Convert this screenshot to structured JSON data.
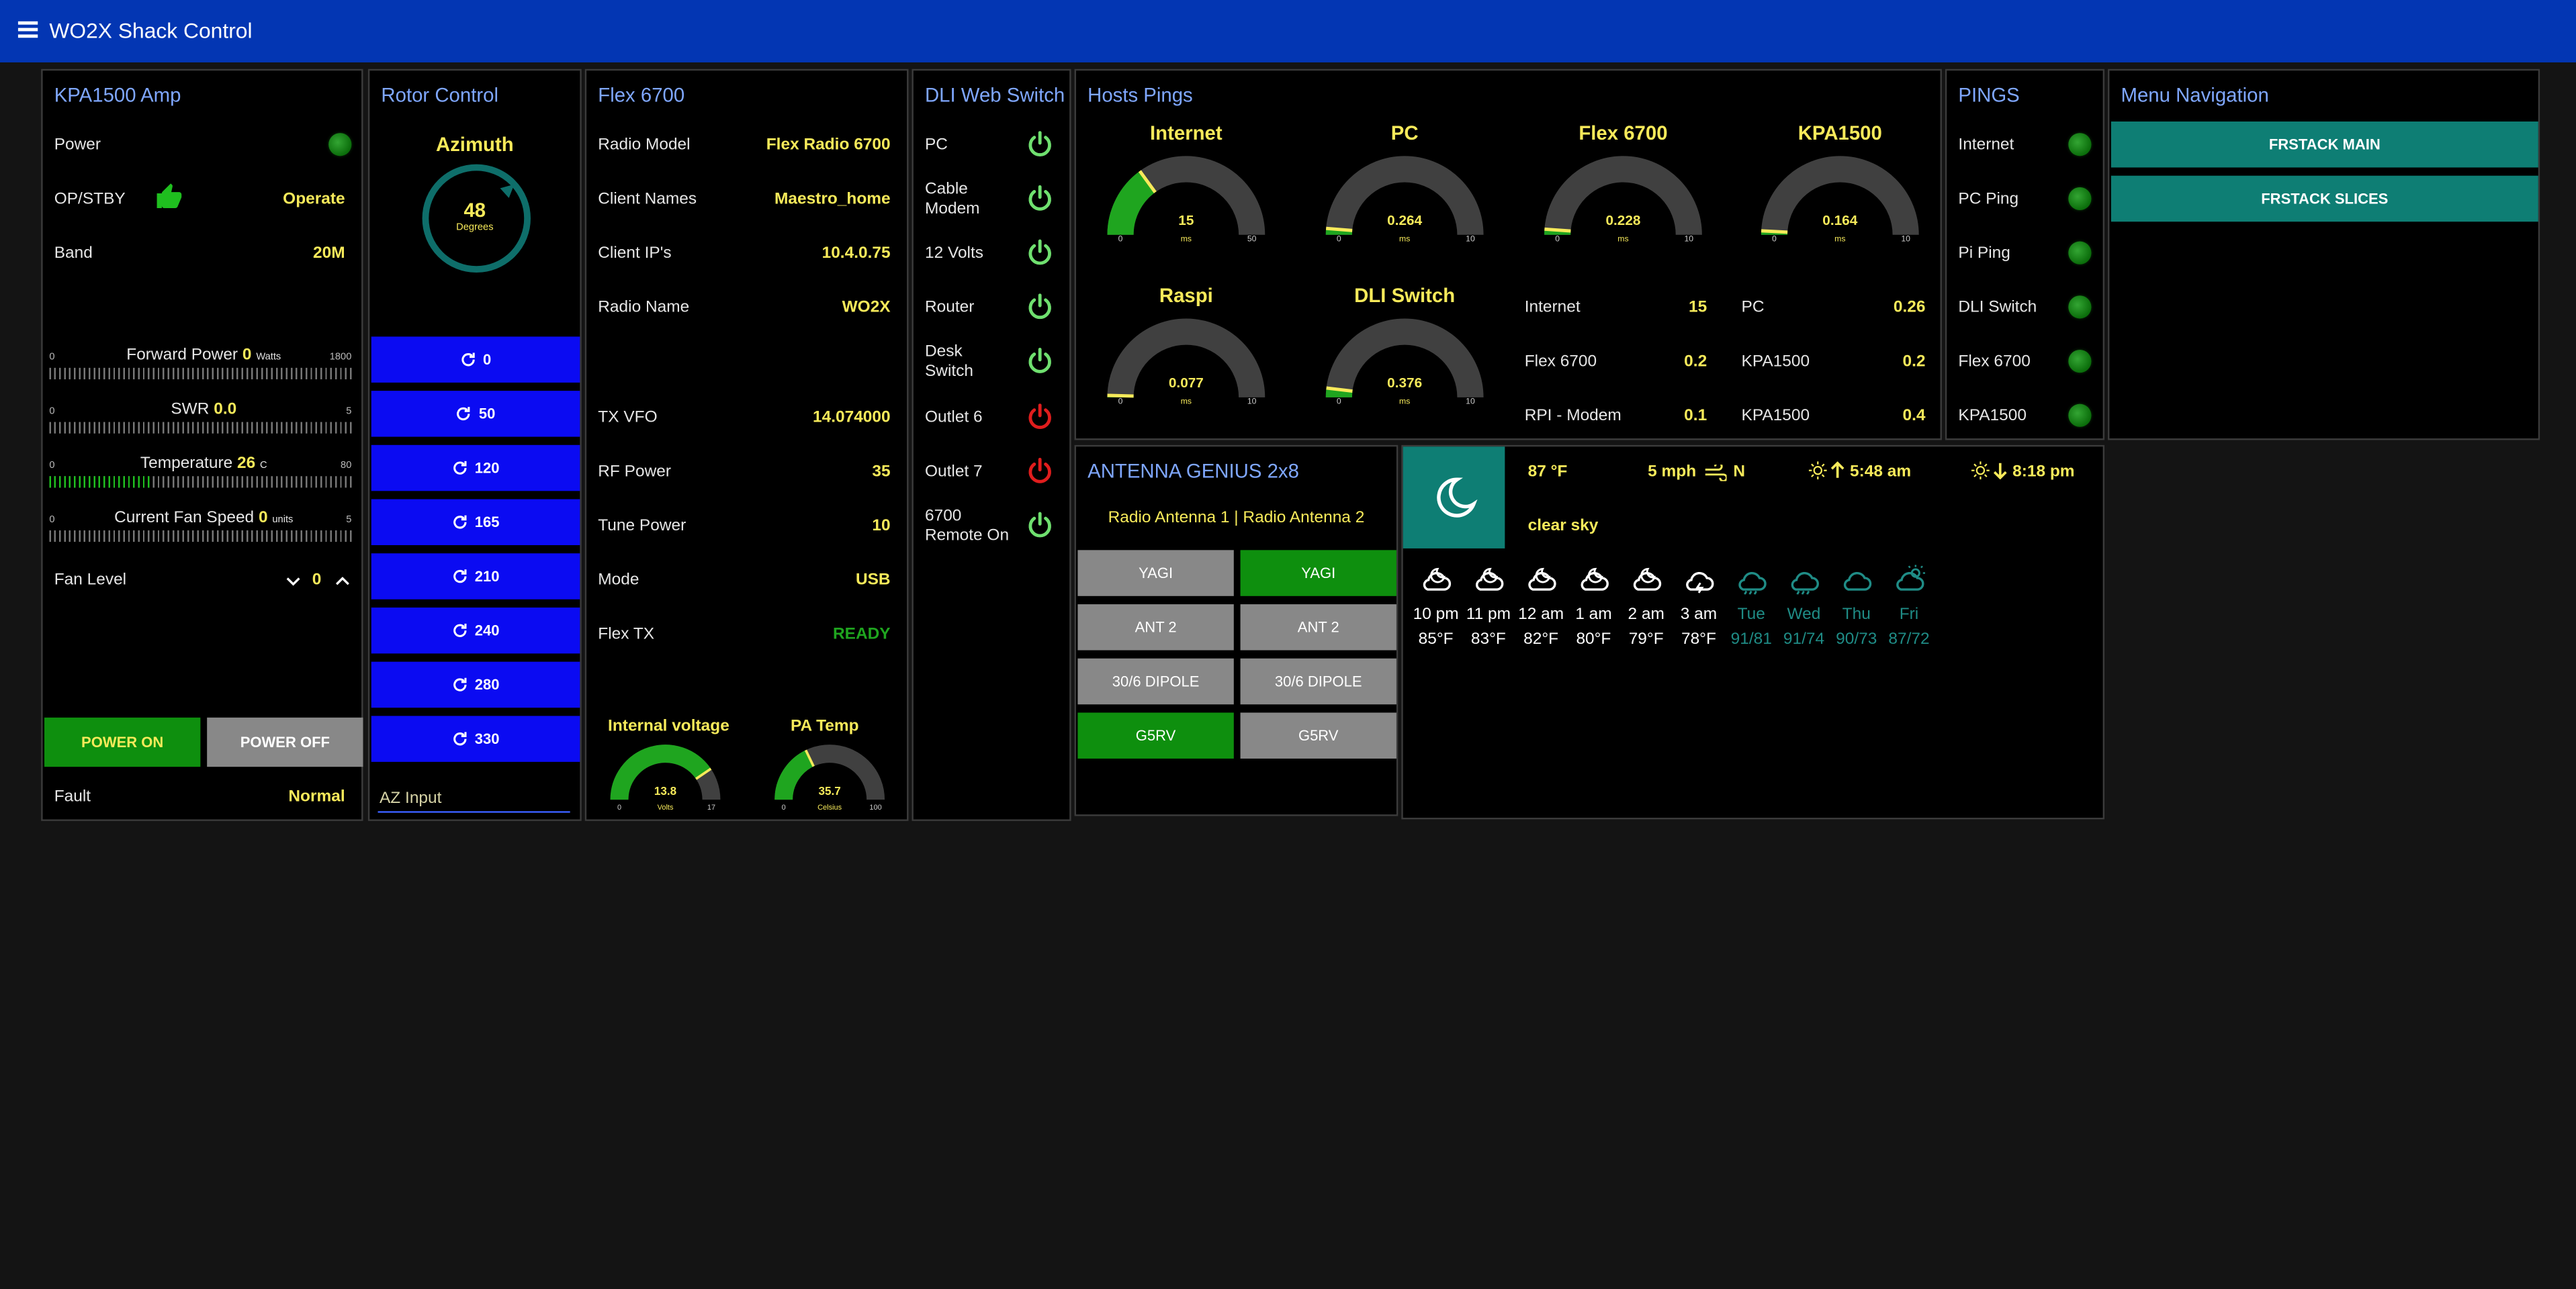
{
  "app": {
    "title": "WO2X Shack Control"
  },
  "amp": {
    "title": "KPA1500 Amp",
    "power_label": "Power",
    "opstby_label": "OP/STBY",
    "opstby_value": "Operate",
    "band_label": "Band",
    "band_value": "20M",
    "fwd": {
      "label": "Forward Power",
      "value": "0",
      "unit": "Watts",
      "min": "0",
      "max": "1800",
      "fraction": 0
    },
    "swr": {
      "label": "SWR",
      "value": "0.0",
      "unit": "",
      "min": "0",
      "max": "5",
      "fraction": 0
    },
    "temp": {
      "label": "Temperature",
      "value": "26",
      "unit": "C",
      "min": "0",
      "max": "80",
      "fraction": 0.33
    },
    "fan": {
      "label": "Current Fan Speed",
      "value": "0",
      "unit": "units",
      "min": "0",
      "max": "5",
      "fraction": 0
    },
    "fan_level_label": "Fan Level",
    "fan_level_value": "0",
    "power_on": "POWER ON",
    "power_off": "POWER OFF",
    "fault_label": "Fault",
    "fault_value": "Normal"
  },
  "rotor": {
    "title": "Rotor Control",
    "azimuth_label": "Azimuth",
    "azimuth_value": "48",
    "azimuth_unit": "Degrees",
    "presets": [
      "0",
      "50",
      "120",
      "165",
      "210",
      "240",
      "280",
      "330"
    ],
    "input_placeholder": "AZ Input"
  },
  "flex": {
    "title": "Flex 6700",
    "rows": [
      {
        "label": "Radio Model",
        "value": "Flex Radio 6700"
      },
      {
        "label": "Client Names",
        "value": "Maestro_home"
      },
      {
        "label": "Client IP's",
        "value": "10.4.0.75"
      },
      {
        "label": "Radio Name",
        "value": "WO2X"
      },
      {
        "label": "TX VFO",
        "value": "14.074000"
      },
      {
        "label": "RF Power",
        "value": "35"
      },
      {
        "label": "Tune Power",
        "value": "10"
      },
      {
        "label": "Mode",
        "value": "USB"
      },
      {
        "label": "Flex TX",
        "value": "READY"
      }
    ],
    "voltage": {
      "title": "Internal voltage",
      "value": "13.8",
      "unit": "Volts",
      "min": "0",
      "max": "17",
      "fraction": 0.81
    },
    "patemp": {
      "title": "PA Temp",
      "value": "35.7",
      "unit": "Celsius",
      "min": "0",
      "max": "100",
      "fraction": 0.357
    }
  },
  "dli": {
    "title": "DLI Web Switch",
    "outlets": [
      {
        "label": "PC",
        "state": "on"
      },
      {
        "label": "Cable Modem",
        "state": "on"
      },
      {
        "label": "12 Volts",
        "state": "on"
      },
      {
        "label": "Router",
        "state": "on"
      },
      {
        "label": "Desk Switch",
        "state": "on"
      },
      {
        "label": "Outlet 6",
        "state": "off"
      },
      {
        "label": "Outlet 7",
        "state": "off"
      },
      {
        "label": "6700 Remote On",
        "state": "on"
      }
    ],
    "colors": {
      "on": "#6fe06f",
      "off": "#e01d1d"
    }
  },
  "hosts": {
    "title": "Hosts Pings",
    "gauges": [
      {
        "name": "Internet",
        "value": "15",
        "unit": "ms",
        "min": "0",
        "max": "50",
        "fraction": 0.3
      },
      {
        "name": "PC",
        "value": "0.264",
        "unit": "ms",
        "min": "0",
        "max": "10",
        "fraction": 0.026
      },
      {
        "name": "Flex 6700",
        "value": "0.228",
        "unit": "ms",
        "min": "0",
        "max": "10",
        "fraction": 0.023
      },
      {
        "name": "KPA1500",
        "value": "0.164",
        "unit": "ms",
        "min": "0",
        "max": "10",
        "fraction": 0.016
      },
      {
        "name": "Raspi",
        "value": "0.077",
        "unit": "ms",
        "min": "0",
        "max": "10",
        "fraction": 0.008
      },
      {
        "name": "DLI Switch",
        "value": "0.376",
        "unit": "ms",
        "min": "0",
        "max": "10",
        "fraction": 0.038
      }
    ],
    "stats_left": [
      {
        "label": "Internet",
        "value": "15"
      },
      {
        "label": "Flex 6700",
        "value": "0.2"
      },
      {
        "label": "RPI - Modem",
        "value": "0.1"
      }
    ],
    "stats_right": [
      {
        "label": "PC",
        "value": "0.26"
      },
      {
        "label": "KPA1500",
        "value": "0.2"
      },
      {
        "label": "KPA1500",
        "value": "0.4"
      }
    ]
  },
  "pings": {
    "title": "PINGS",
    "items": [
      "Internet",
      "PC Ping",
      "Pi Ping",
      "DLI Switch",
      "Flex 6700",
      "KPA1500"
    ]
  },
  "nav": {
    "title": "Menu Navigation",
    "buttons": [
      "FRSTACK MAIN",
      "FRSTACK SLICES"
    ]
  },
  "antenna": {
    "title": "ANTENNA GENIUS 2x8",
    "header": "Radio Antenna 1 | Radio Antenna 2",
    "radio1": [
      {
        "label": "YAGI",
        "active": false
      },
      {
        "label": "ANT 2",
        "active": false
      },
      {
        "label": "30/6 DIPOLE",
        "active": false
      },
      {
        "label": "G5RV",
        "active": true
      }
    ],
    "radio2": [
      {
        "label": "YAGI",
        "active": true
      },
      {
        "label": "ANT 2",
        "active": false
      },
      {
        "label": "30/6 DIPOLE",
        "active": false
      },
      {
        "label": "G5RV",
        "active": false
      }
    ]
  },
  "weather": {
    "temp": "87 °F",
    "wind": "5 mph",
    "wind_dir": "N",
    "sunrise": "5:48 am",
    "sunset": "8:18 pm",
    "condition": "clear sky",
    "condition_icon": "moon-icon",
    "hourly": [
      {
        "time": "10 pm",
        "temp": "85°F",
        "icon": "cloudy-night-icon"
      },
      {
        "time": "11 pm",
        "temp": "83°F",
        "icon": "partly-cloudy-night-icon"
      },
      {
        "time": "12 am",
        "temp": "82°F",
        "icon": "partly-cloudy-night-icon"
      },
      {
        "time": "1 am",
        "temp": "80°F",
        "icon": "cloudy-night-icon"
      },
      {
        "time": "2 am",
        "temp": "79°F",
        "icon": "cloudy-night-icon"
      },
      {
        "time": "3 am",
        "temp": "78°F",
        "icon": "thunder-cloud-icon"
      }
    ],
    "daily": [
      {
        "day": "Tue",
        "temps": "91/81",
        "icon": "rain-icon"
      },
      {
        "day": "Wed",
        "temps": "91/74",
        "icon": "rain-icon"
      },
      {
        "day": "Thu",
        "temps": "90/73",
        "icon": "cloud-icon"
      },
      {
        "day": "Fri",
        "temps": "87/72",
        "icon": "partly-sunny-icon"
      }
    ],
    "colors": {
      "hourly": "#f7ea5a",
      "daily": "#1f8c86"
    }
  },
  "colors": {
    "accent_blue": "#0336b3",
    "title_blue": "#7fa7ff",
    "value_yellow": "#f7ea5a",
    "green": "#0e8f0e",
    "teal": "#0e7e74"
  }
}
